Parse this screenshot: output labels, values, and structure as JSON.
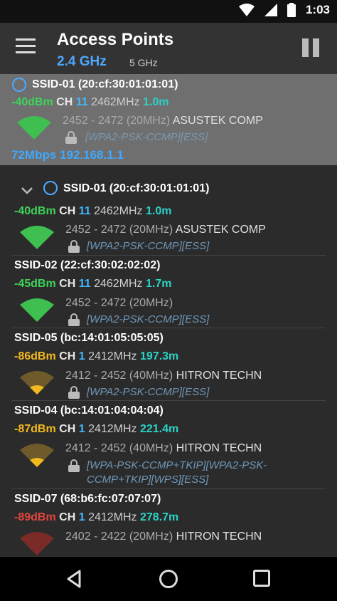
{
  "status_bar": {
    "time": "1:03",
    "icons": [
      "wifi-icon",
      "cell-signal-icon",
      "battery-icon"
    ]
  },
  "app_bar": {
    "title": "Access Points",
    "tab_24": "2.4 GHz",
    "tab_5": "5 GHz"
  },
  "colors": {
    "accent": "#4ea8ff",
    "good": "#3fd35a",
    "fair": "#f2b81f",
    "bad": "#e0453d",
    "distance": "#2bd3c6"
  },
  "connected": {
    "ssid": "SSID-01 (20:cf:30:01:01:01)",
    "dbm": "-40dBm",
    "ch_label": "CH",
    "ch": "11",
    "freq": "2462MHz",
    "dist": "1.0m",
    "range": "2452 - 2472 (20MHz)",
    "vendor": "ASUSTEK COMP",
    "security": "[WPA2-PSK-CCMP][ESS]",
    "speed": "72Mbps",
    "ip": "192.168.1.1"
  },
  "access_points": [
    {
      "ssid": "SSID-01 (20:cf:30:01:01:01)",
      "dbm": "-40dBm",
      "ch_label": "CH",
      "ch": "11",
      "freq": "2462MHz",
      "dist": "1.0m",
      "range": "2452 - 2472 (20MHz)",
      "vendor": "ASUSTEK COMP",
      "security": "[WPA2-PSK-CCMP][ESS]"
    },
    {
      "ssid": "SSID-02 (22:cf:30:02:02:02)",
      "dbm": "-45dBm",
      "ch_label": "CH",
      "ch": "11",
      "freq": "2462MHz",
      "dist": "1.7m",
      "range": "2452 - 2472 (20MHz)",
      "vendor": "",
      "security": "[WPA2-PSK-CCMP][ESS]"
    },
    {
      "ssid": "SSID-05 (bc:14:01:05:05:05)",
      "dbm": "-86dBm",
      "ch_label": "CH",
      "ch": "1",
      "freq": "2412MHz",
      "dist": "197.3m",
      "range": "2412 - 2452 (40MHz)",
      "vendor": "HITRON TECHN",
      "security": "[WPA2-PSK-CCMP][ESS]"
    },
    {
      "ssid": "SSID-04 (bc:14:01:04:04:04)",
      "dbm": "-87dBm",
      "ch_label": "CH",
      "ch": "1",
      "freq": "2412MHz",
      "dist": "221.4m",
      "range": "2412 - 2452 (40MHz)",
      "vendor": "HITRON TECHN",
      "security_line1": "[WPA-PSK-CCMP+TKIP][WPA2-PSK-",
      "security_line2": "CCMP+TKIP][WPS][ESS]"
    },
    {
      "ssid": "SSID-07 (68:b6:fc:07:07:07)",
      "dbm": "-89dBm",
      "ch_label": "CH",
      "ch": "1",
      "freq": "2412MHz",
      "dist": "278.7m",
      "range": "2402 - 2422 (20MHz)",
      "vendor": "HITRON TECHN"
    }
  ]
}
